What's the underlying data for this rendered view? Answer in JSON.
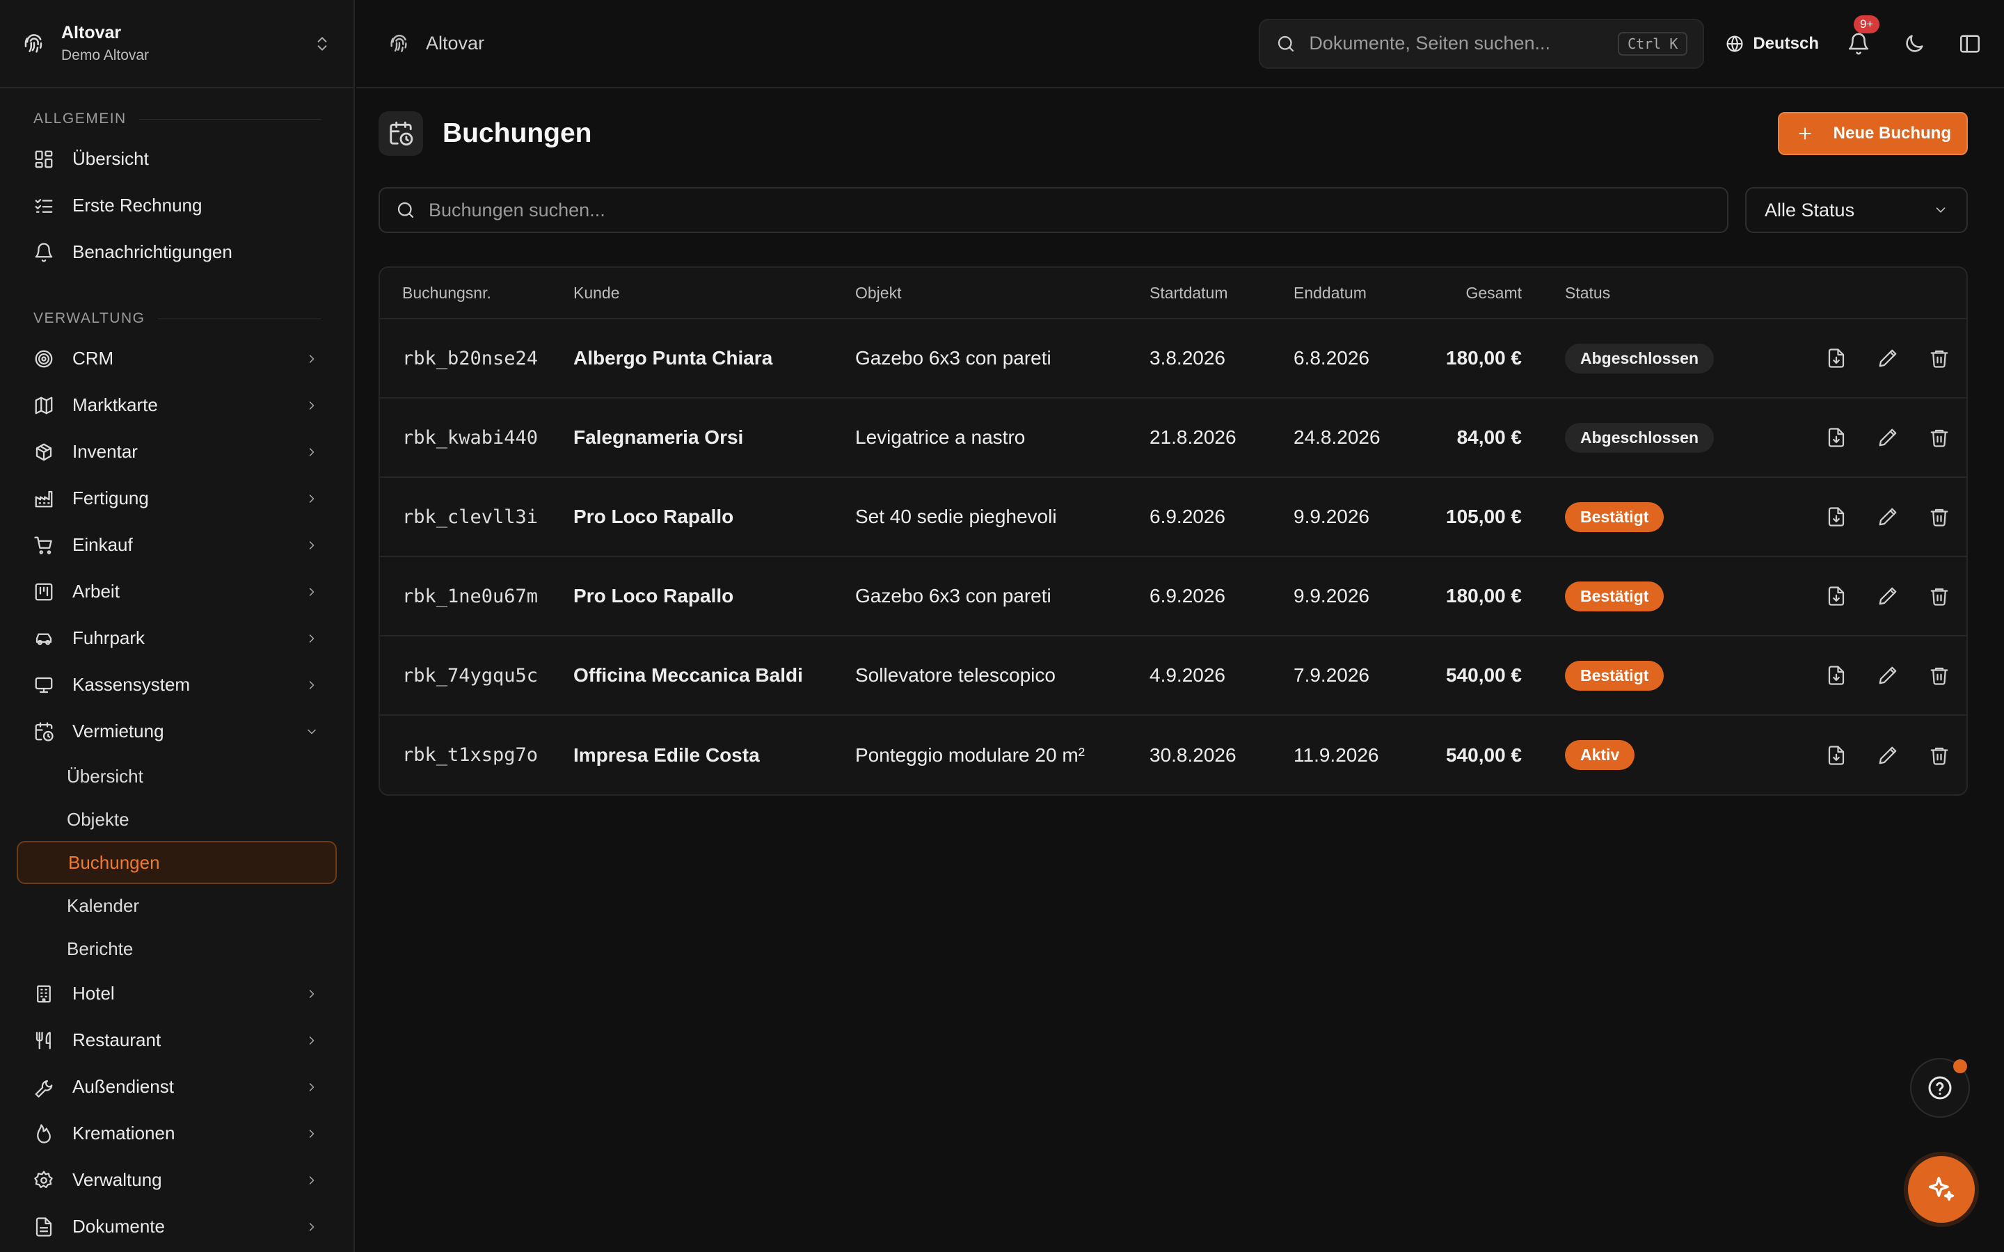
{
  "brand": {
    "name": "Altovar",
    "subtitle": "Demo Altovar"
  },
  "sidebar": {
    "section_general": "ALLGEMEIN",
    "general_items": [
      {
        "label": "Übersicht",
        "icon": "dashboard-icon"
      },
      {
        "label": "Erste Rechnung",
        "icon": "checklist-icon"
      },
      {
        "label": "Benachrichtigungen",
        "icon": "bell-icon"
      }
    ],
    "section_admin": "VERWALTUNG",
    "admin_items": [
      {
        "label": "CRM"
      },
      {
        "label": "Marktkarte"
      },
      {
        "label": "Inventar"
      },
      {
        "label": "Fertigung"
      },
      {
        "label": "Einkauf"
      },
      {
        "label": "Arbeit"
      },
      {
        "label": "Fuhrpark"
      },
      {
        "label": "Kassensystem"
      },
      {
        "label": "Vermietung"
      },
      {
        "label": "Hotel"
      },
      {
        "label": "Restaurant"
      },
      {
        "label": "Außendienst"
      },
      {
        "label": "Kremationen"
      },
      {
        "label": "Verwaltung"
      },
      {
        "label": "Dokumente"
      }
    ],
    "rental_sub": [
      {
        "label": "Übersicht"
      },
      {
        "label": "Objekte"
      },
      {
        "label": "Buchungen"
      },
      {
        "label": "Kalender"
      },
      {
        "label": "Berichte"
      }
    ]
  },
  "header": {
    "breadcrumb": "Altovar",
    "search_placeholder": "Dokumente, Seiten suchen...",
    "search_shortcut": "Ctrl K",
    "language": "Deutsch",
    "notification_badge": "9+"
  },
  "page": {
    "title": "Buchungen",
    "new_button": "Neue Buchung",
    "search_placeholder": "Buchungen suchen...",
    "status_filter": "Alle Status"
  },
  "table": {
    "columns": {
      "id": "Buchungsnr.",
      "customer": "Kunde",
      "object": "Objekt",
      "start": "Startdatum",
      "end": "Enddatum",
      "total": "Gesamt",
      "status": "Status"
    },
    "rows": [
      {
        "id": "rbk_b20nse24",
        "customer": "Albergo Punta Chiara",
        "object": "Gazebo 6x3 con pareti",
        "start": "3.8.2026",
        "end": "6.8.2026",
        "total": "180,00 €",
        "status": "Abgeschlossen"
      },
      {
        "id": "rbk_kwabi440",
        "customer": "Falegnameria Orsi",
        "object": "Levigatrice a nastro",
        "start": "21.8.2026",
        "end": "24.8.2026",
        "total": "84,00 €",
        "status": "Abgeschlossen"
      },
      {
        "id": "rbk_clevll3i",
        "customer": "Pro Loco Rapallo",
        "object": "Set 40 sedie pieghevoli",
        "start": "6.9.2026",
        "end": "9.9.2026",
        "total": "105,00 €",
        "status": "Bestätigt"
      },
      {
        "id": "rbk_1ne0u67m",
        "customer": "Pro Loco Rapallo",
        "object": "Gazebo 6x3 con pareti",
        "start": "6.9.2026",
        "end": "9.9.2026",
        "total": "180,00 €",
        "status": "Bestätigt"
      },
      {
        "id": "rbk_74ygqu5c",
        "customer": "Officina Meccanica Baldi",
        "object": "Sollevatore telescopico",
        "start": "4.9.2026",
        "end": "7.9.2026",
        "total": "540,00 €",
        "status": "Bestätigt"
      },
      {
        "id": "rbk_t1xspg7o",
        "customer": "Impresa Edile Costa",
        "object": "Ponteggio modulare 20 m²",
        "start": "30.8.2026",
        "end": "11.9.2026",
        "total": "540,00 €",
        "status": "Aktiv"
      }
    ]
  },
  "colors": {
    "accent": "#e0651f",
    "background": "#101010",
    "sidebar": "#151515",
    "badge_red": "#d63a3a"
  }
}
